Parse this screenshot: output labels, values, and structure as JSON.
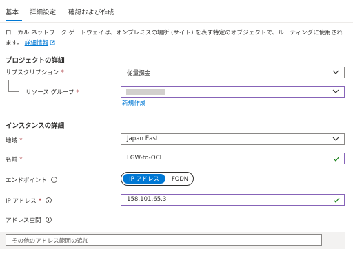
{
  "tabs": [
    {
      "label": "基本",
      "active": true
    },
    {
      "label": "詳細設定",
      "active": false
    },
    {
      "label": "確認および作成",
      "active": false
    }
  ],
  "description": {
    "text": "ローカル ネットワーク ゲートウェイは、オンプレミスの場所 (サイト) を表す特定のオブジェクトで、ルーティングに使用されます。",
    "link": "詳細情報"
  },
  "project": {
    "title": "プロジェクトの詳細",
    "subscription_label": "サブスクリプション",
    "subscription_value": "従量課金",
    "resource_group_label": "リソース グループ",
    "resource_group_value": "",
    "create_new": "新規作成"
  },
  "instance": {
    "title": "インスタンスの詳細",
    "region_label": "地域",
    "region_value": "Japan East",
    "name_label": "名前",
    "name_value": "LGW-to-OCI",
    "endpoint_label": "エンドポイント",
    "endpoint_options": [
      "IP アドレス",
      "FQDN"
    ],
    "endpoint_selected": "IP アドレス",
    "ip_label": "IP アドレス",
    "ip_value": "158.101.65.3",
    "address_space_label": "アドレス空間",
    "address_space_placeholder": "その他のアドレス範囲の追加"
  },
  "required_marker": "*",
  "colors": {
    "accent": "#0078d4",
    "required": "#a4262c",
    "valid_check": "#107c10",
    "focus_border": "#8764b8"
  }
}
